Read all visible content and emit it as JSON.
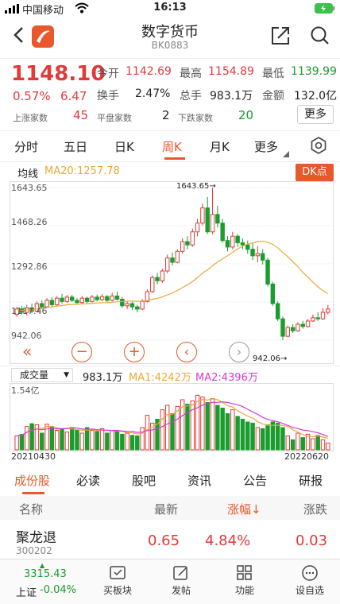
{
  "status_bar": {
    "carrier": "中国移动",
    "time": "16:13"
  },
  "header": {
    "title": "数字货币",
    "code": "BK0883"
  },
  "quote": {
    "price": "1148.10",
    "change_pct": "0.57%",
    "change": "6.47",
    "open_label": "今开",
    "open": "1142.69",
    "high_label": "最高",
    "high": "1154.89",
    "low_label": "最低",
    "low": "1139.99",
    "turnover_label": "换手",
    "turnover": "2.47%",
    "volume_label": "总手",
    "volume": "983.1万",
    "amount_label": "金额",
    "amount": "132.0亿",
    "up_label": "上涨家数",
    "up": "45",
    "flat_label": "平盘家数",
    "flat": "2",
    "down_label": "下跌家数",
    "down": "20",
    "more": "更多"
  },
  "chart_tabs": [
    "分时",
    "五日",
    "日K",
    "周K",
    "月K",
    "更多"
  ],
  "chart_tab_active": "周K",
  "kline": {
    "ma_label": "均线",
    "ma20_text": "MA20:1257.78",
    "dk_button": "DK点",
    "y_ticks": [
      "1643.65",
      "1468.26",
      "1292.86",
      "1117.46",
      "942.06"
    ],
    "max_mark": "1643.65",
    "min_mark": "942.06"
  },
  "volume_panel": {
    "selector": "成交量",
    "value": "983.1万",
    "ma1": "MA1:4242万",
    "ma2": "MA2:4396万",
    "y_top": "1.54亿",
    "date_start": "20210430",
    "date_end": "20220620"
  },
  "chart_data": {
    "type": "candlestick",
    "ylim": [
      942.06,
      1643.65
    ],
    "candles": [
      [
        1060,
        1085,
        1050,
        1095
      ],
      [
        1085,
        1070,
        1060,
        1100
      ],
      [
        1070,
        1090,
        1055,
        1105
      ],
      [
        1090,
        1075,
        1065,
        1110
      ],
      [
        1075,
        1110,
        1070,
        1120
      ],
      [
        1110,
        1095,
        1085,
        1125
      ],
      [
        1095,
        1125,
        1090,
        1135
      ],
      [
        1125,
        1105,
        1095,
        1140
      ],
      [
        1105,
        1135,
        1100,
        1145
      ],
      [
        1135,
        1120,
        1110,
        1155
      ],
      [
        1120,
        1140,
        1112,
        1150
      ],
      [
        1140,
        1125,
        1118,
        1150
      ],
      [
        1125,
        1115,
        1105,
        1135
      ],
      [
        1115,
        1135,
        1108,
        1145
      ],
      [
        1135,
        1120,
        1112,
        1142
      ],
      [
        1120,
        1140,
        1115,
        1150
      ],
      [
        1140,
        1128,
        1120,
        1152
      ],
      [
        1128,
        1142,
        1122,
        1155
      ],
      [
        1142,
        1125,
        1118,
        1150
      ],
      [
        1125,
        1145,
        1120,
        1160
      ],
      [
        1145,
        1130,
        1125,
        1165
      ],
      [
        1130,
        1100,
        1090,
        1140
      ],
      [
        1100,
        1110,
        1085,
        1120
      ],
      [
        1110,
        1095,
        1080,
        1118
      ],
      [
        1095,
        1085,
        1070,
        1105
      ],
      [
        1085,
        1120,
        1080,
        1130
      ],
      [
        1120,
        1165,
        1115,
        1175
      ],
      [
        1165,
        1230,
        1160,
        1240
      ],
      [
        1230,
        1215,
        1200,
        1250
      ],
      [
        1215,
        1260,
        1205,
        1270
      ],
      [
        1260,
        1320,
        1250,
        1335
      ],
      [
        1320,
        1300,
        1285,
        1345
      ],
      [
        1300,
        1350,
        1295,
        1360
      ],
      [
        1350,
        1395,
        1340,
        1410
      ],
      [
        1395,
        1380,
        1360,
        1420
      ],
      [
        1380,
        1440,
        1370,
        1455
      ],
      [
        1440,
        1480,
        1420,
        1500
      ],
      [
        1480,
        1550,
        1470,
        1570
      ],
      [
        1550,
        1440,
        1430,
        1600
      ],
      [
        1440,
        1520,
        1430,
        1643
      ],
      [
        1520,
        1480,
        1460,
        1560
      ],
      [
        1480,
        1400,
        1390,
        1500
      ],
      [
        1400,
        1370,
        1350,
        1420
      ],
      [
        1370,
        1420,
        1360,
        1440
      ],
      [
        1420,
        1390,
        1370,
        1430
      ],
      [
        1390,
        1380,
        1360,
        1410
      ],
      [
        1380,
        1360,
        1340,
        1400
      ],
      [
        1360,
        1330,
        1310,
        1390
      ],
      [
        1330,
        1340,
        1300,
        1375
      ],
      [
        1340,
        1310,
        1290,
        1360
      ],
      [
        1310,
        1200,
        1190,
        1320
      ],
      [
        1200,
        1110,
        1100,
        1210
      ],
      [
        1110,
        1040,
        1030,
        1120
      ],
      [
        1040,
        960,
        942,
        1050
      ],
      [
        960,
        1000,
        955,
        1010
      ],
      [
        1000,
        985,
        975,
        1015
      ],
      [
        985,
        1015,
        980,
        1025
      ],
      [
        1015,
        1005,
        995,
        1030
      ],
      [
        1005,
        1030,
        1000,
        1040
      ],
      [
        1030,
        1045,
        1025,
        1060
      ],
      [
        1045,
        1040,
        1030,
        1070
      ],
      [
        1040,
        1070,
        1035,
        1090
      ],
      [
        1070,
        1085,
        1060,
        1105
      ]
    ],
    "volumes": [
      0.25,
      0.28,
      0.42,
      0.47,
      0.45,
      0.3,
      0.46,
      0.42,
      0.35,
      0.38,
      0.32,
      0.4,
      0.36,
      0.3,
      0.4,
      0.35,
      0.33,
      0.38,
      0.3,
      0.35,
      0.33,
      0.28,
      0.3,
      0.26,
      0.25,
      0.4,
      0.62,
      0.48,
      0.55,
      0.72,
      0.8,
      0.65,
      0.78,
      0.9,
      0.82,
      0.88,
      0.98,
      0.95,
      0.85,
      0.92,
      0.8,
      0.75,
      0.65,
      0.72,
      0.6,
      0.55,
      0.5,
      0.48,
      0.4,
      0.38,
      0.45,
      0.5,
      0.48,
      0.4,
      0.25,
      0.18,
      0.3,
      0.22,
      0.28,
      0.2,
      0.26,
      0.18,
      0.12
    ]
  },
  "bottom_tabs": [
    "成份股",
    "必读",
    "股吧",
    "资讯",
    "公告",
    "研报"
  ],
  "bottom_tab_active": "成份股",
  "list": {
    "col_name": "名称",
    "col_price": "最新",
    "col_pct": "涨幅↓",
    "col_change": "涨跌",
    "rows": [
      {
        "name": "聚龙退",
        "code": "300202",
        "price": "0.65",
        "pct": "4.84%",
        "change": "0.03"
      }
    ]
  },
  "index_bar": {
    "value": "3315.43",
    "name": "上证",
    "pct": "-0.04%"
  },
  "bottom_nav": [
    "买板块",
    "发帖",
    "功能",
    "设自选"
  ]
}
